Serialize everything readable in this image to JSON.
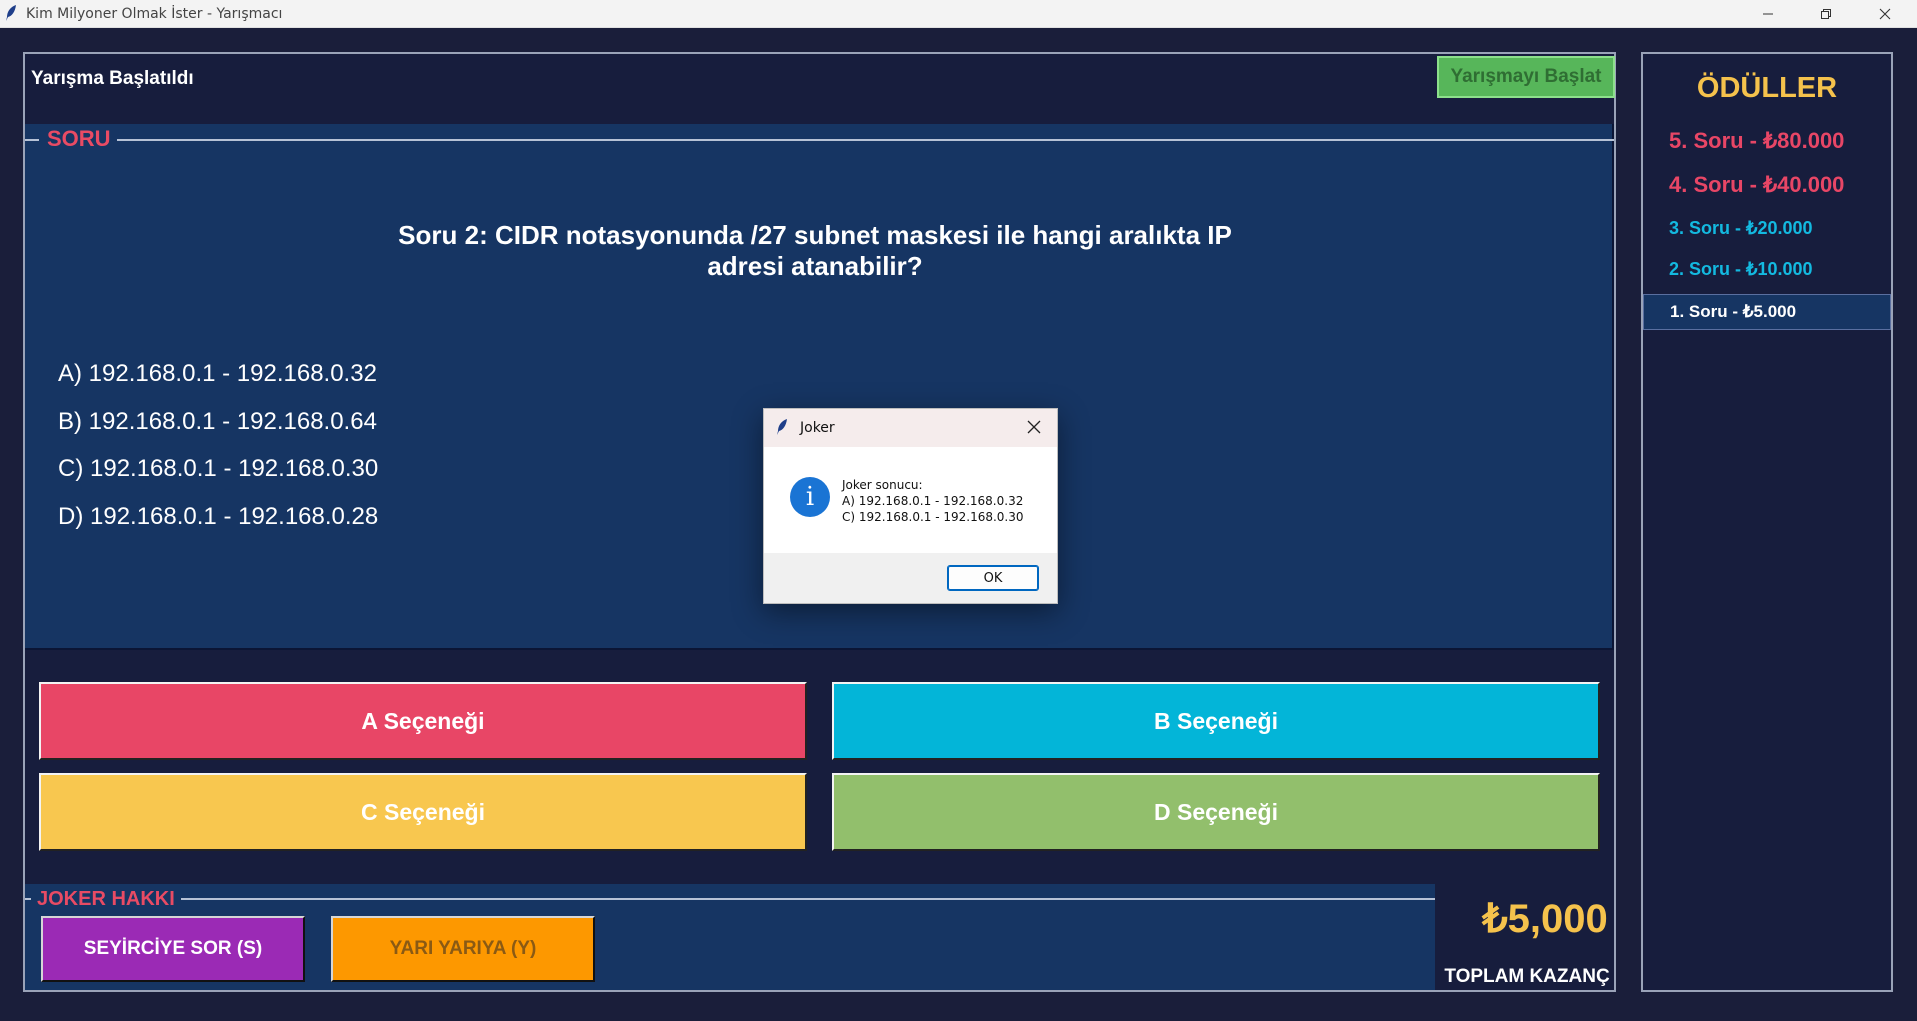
{
  "window": {
    "title": "Kim Milyoner Olmak İster - Yarışmacı"
  },
  "header": {
    "status": "Yarışma Başlatıldı",
    "start_button": "Yarışmayı Başlat"
  },
  "question_panel": {
    "label": "SORU",
    "question_line1": "Soru 2: CIDR notasyonunda /27 subnet maskesi ile hangi aralıkta IP",
    "question_line2": "adresi atanabilir?",
    "options": [
      "A) 192.168.0.1 - 192.168.0.32",
      "B) 192.168.0.1 - 192.168.0.64",
      "C) 192.168.0.1 - 192.168.0.30",
      "D) 192.168.0.1 - 192.168.0.28"
    ]
  },
  "answers": [
    {
      "label": "A Seçeneği",
      "color": "#e84666"
    },
    {
      "label": "B Seçeneği",
      "color": "#03b5d8"
    },
    {
      "label": "C Seçeneği",
      "color": "#f8c74f"
    },
    {
      "label": "D Seçeneği",
      "color": "#92bf6c"
    }
  ],
  "joker": {
    "label": "JOKER HAKKI",
    "audience_button": "SEYİRCİYE SOR (S)",
    "fifty_button": "YARI YARIYA (Y)"
  },
  "earnings": {
    "amount": "₺5,000",
    "label": "TOPLAM KAZANÇ"
  },
  "prizes": {
    "title": "ÖDÜLLER",
    "items": [
      {
        "label": "5. Soru - ₺80.000",
        "color": "#e84666"
      },
      {
        "label": "4. Soru - ₺40.000",
        "color": "#e84666"
      },
      {
        "label": "3. Soru - ₺20.000",
        "color": "#13b9e0"
      },
      {
        "label": "2. Soru - ₺10.000",
        "color": "#13b9e0"
      },
      {
        "label": "1. Soru - ₺5.000",
        "color": "#ffffff",
        "highlighted": true
      }
    ]
  },
  "dialog": {
    "title": "Joker",
    "message_line1": "Joker sonucu:",
    "message_line2": "A) 192.168.0.1 - 192.168.0.32",
    "message_line3": "C) 192.168.0.1 - 192.168.0.30",
    "ok_button": "OK"
  }
}
